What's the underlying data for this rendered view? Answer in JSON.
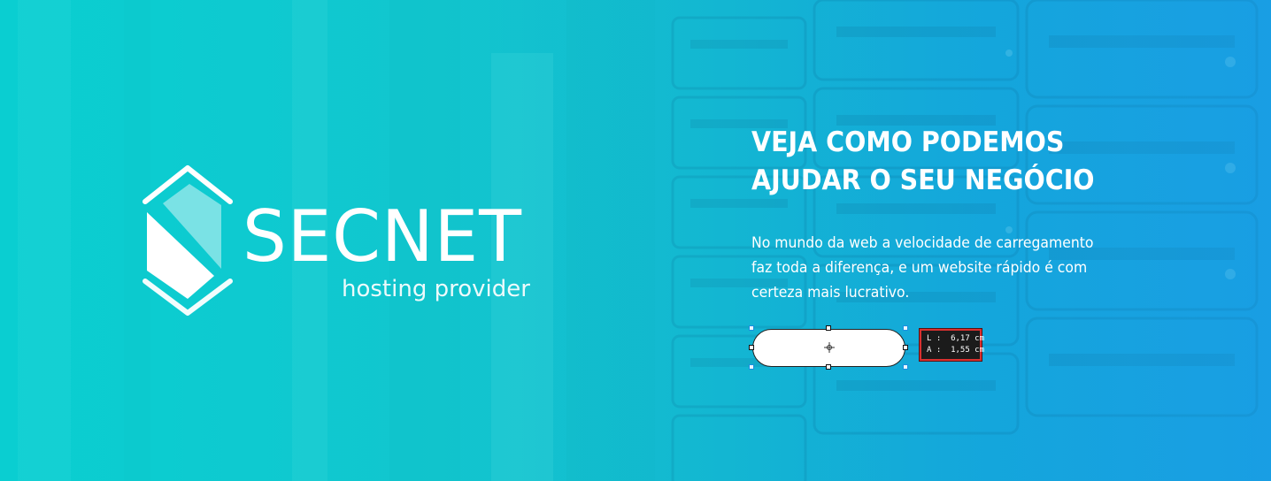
{
  "brand": {
    "name": "SECNET",
    "tagline": "hosting provider"
  },
  "hero": {
    "headline_line1": "VEJA COMO PODEMOS",
    "headline_line2": "AJUDAR O SEU NEGÓCIO",
    "desc_line1": "No mundo da web a velocidade de carregamento",
    "desc_line2": "faz toda a diferença, e um website rápido é com",
    "desc_line3": "certeza mais lucrativo."
  },
  "selection": {
    "width_readout": "L :  6,17 cm",
    "height_readout": "A :  1,55 cm"
  },
  "colors": {
    "bg_left": "#0ccfd2",
    "bg_right": "#1a9ee3",
    "text": "#ffffff",
    "tooltip_bg": "#1b1b1b",
    "tooltip_border": "#d9302f"
  },
  "icons": {
    "logo_mark": "hexagon-shield-logo",
    "move_cursor": "crosshair-move-icon"
  }
}
